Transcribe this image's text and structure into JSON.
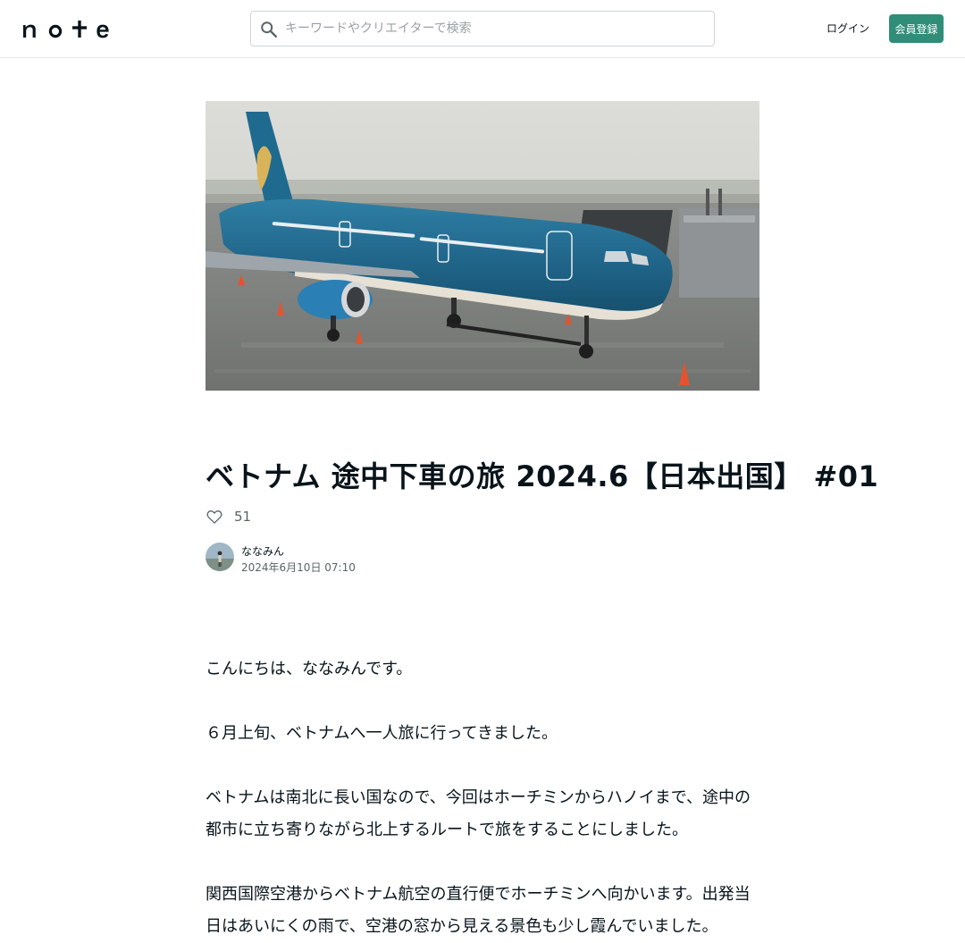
{
  "header": {
    "logo_text": "note",
    "search": {
      "placeholder": "キーワードやクリエイターで検索",
      "value": ""
    },
    "login_label": "ログイン",
    "signup_label": "会員登録",
    "brand_color": "#2f8d78"
  },
  "hero": {
    "icon": "airplane-photo"
  },
  "article": {
    "title": "ベトナム 途中下車の旅 2024.6【日本出国】 #01",
    "like_count": "51",
    "like_icon": "heart-icon"
  },
  "author": {
    "name": "ななみん",
    "date": "2024年6月10日 07:10"
  },
  "body": {
    "paragraphs": [
      "こんにちは、ななみんです。",
      "６月上旬、ベトナムへ一人旅に行ってきました。",
      "ベトナムは南北に長い国なので、今回はホーチミンからハノイまで、途中の都市に立ち寄りながら北上するルートで旅をすることにしました。",
      "関西国際空港からベトナム航空の直行便でホーチミンへ向かいます。出発当日はあいにくの雨で、空港の窓から見える景色も少し霞んでいました。"
    ]
  }
}
